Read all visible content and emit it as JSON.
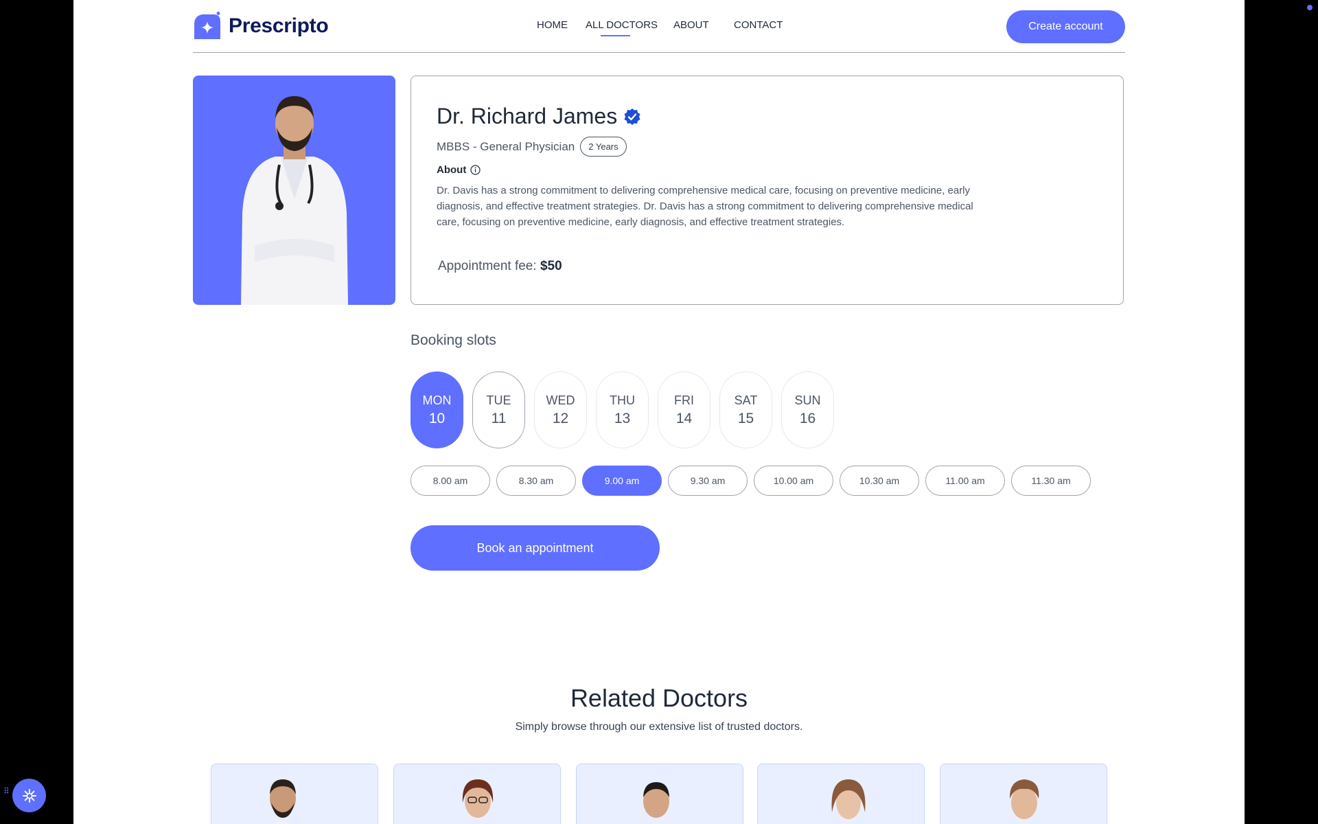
{
  "brand": {
    "name": "Prescripto"
  },
  "nav": {
    "items": [
      {
        "label": "HOME"
      },
      {
        "label": "ALL DOCTORS"
      },
      {
        "label": "ABOUT"
      },
      {
        "label": "CONTACT"
      }
    ],
    "active": "ALL DOCTORS",
    "create_account": "Create account"
  },
  "doctor": {
    "name": "Dr. Richard James",
    "degree_speciality": "MBBS - General Physician",
    "experience": "2 Years",
    "about_label": "About",
    "about_text": "Dr. Davis has a strong commitment to delivering comprehensive medical care, focusing on preventive medicine, early diagnosis, and effective treatment strategies. Dr. Davis has a strong commitment to delivering comprehensive medical care, focusing on preventive medicine, early diagnosis, and effective treatment strategies.",
    "fee_label": "Appointment fee:",
    "fee_value": "$50"
  },
  "booking": {
    "title": "Booking slots",
    "days": [
      {
        "day": "MON",
        "date": "10",
        "selected": true
      },
      {
        "day": "TUE",
        "date": "11"
      },
      {
        "day": "WED",
        "date": "12"
      },
      {
        "day": "THU",
        "date": "13"
      },
      {
        "day": "FRI",
        "date": "14"
      },
      {
        "day": "SAT",
        "date": "15"
      },
      {
        "day": "SUN",
        "date": "16"
      }
    ],
    "times": [
      {
        "label": "8.00 am"
      },
      {
        "label": "8.30 am"
      },
      {
        "label": "9.00 am",
        "selected": true
      },
      {
        "label": "9.30 am"
      },
      {
        "label": "10.00 am"
      },
      {
        "label": "10.30 am"
      },
      {
        "label": "11.00 am"
      },
      {
        "label": "11.30 am"
      }
    ],
    "book_button": "Book an appointment"
  },
  "related": {
    "title": "Related Doctors",
    "subtitle": "Simply browse through our extensive list of trusted doctors."
  },
  "colors": {
    "primary": "#5f6fff",
    "card_bg": "#eaefff",
    "text": "#1f2937"
  }
}
